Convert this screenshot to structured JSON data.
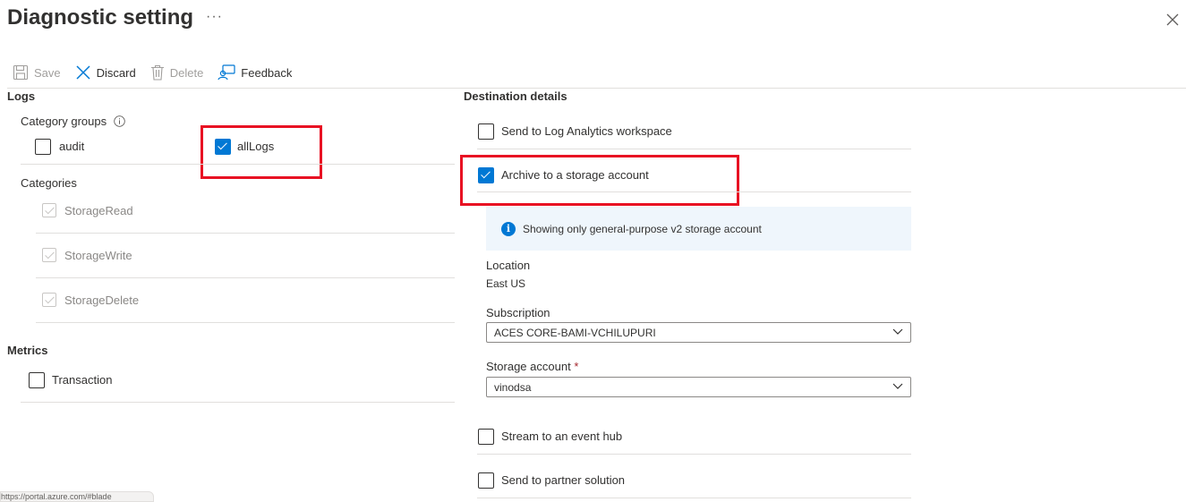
{
  "header": {
    "title": "Diagnostic setting",
    "more": "···"
  },
  "toolbar": {
    "save": "Save",
    "discard": "Discard",
    "delete": "Delete",
    "feedback": "Feedback"
  },
  "logs": {
    "heading": "Logs",
    "category_groups_label": "Category groups",
    "groups": [
      {
        "label": "audit",
        "checked": false
      },
      {
        "label": "allLogs",
        "checked": true
      }
    ],
    "categories_label": "Categories",
    "categories": [
      {
        "label": "StorageRead",
        "checked": true,
        "disabled": true
      },
      {
        "label": "StorageWrite",
        "checked": true,
        "disabled": true
      },
      {
        "label": "StorageDelete",
        "checked": true,
        "disabled": true
      }
    ]
  },
  "metrics": {
    "heading": "Metrics",
    "items": [
      {
        "label": "Transaction",
        "checked": false
      }
    ]
  },
  "destination": {
    "heading": "Destination details",
    "log_analytics": {
      "label": "Send to Log Analytics workspace",
      "checked": false
    },
    "archive": {
      "label": "Archive to a storage account",
      "checked": true
    },
    "info_text": "Showing only general-purpose v2 storage account",
    "location_label": "Location",
    "location_value": "East US",
    "subscription_label": "Subscription",
    "subscription_value": "ACES CORE-BAMI-VCHILUPURI",
    "storage_label": "Storage account",
    "storage_required": "*",
    "storage_value": "vinodsa",
    "event_hub": {
      "label": "Stream to an event hub",
      "checked": false
    },
    "partner": {
      "label": "Send to partner solution",
      "checked": false
    }
  },
  "statusbar": {
    "text": "https://portal.azure.com/#blade"
  },
  "colors": {
    "accent": "#0078d4",
    "highlight": "#e81123",
    "info_bg": "#eff6fc"
  }
}
